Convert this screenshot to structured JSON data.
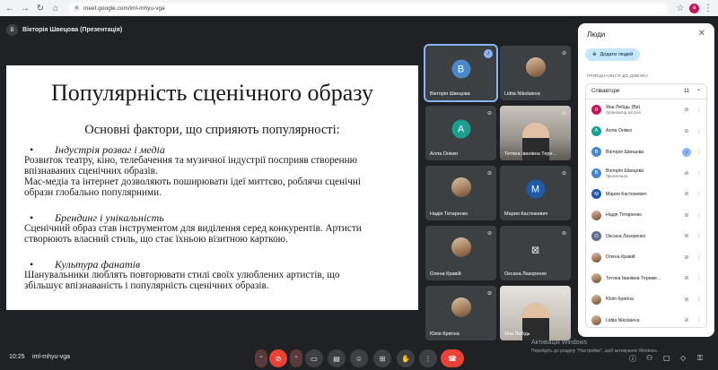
{
  "browser": {
    "url": "meet.google.com/iml-mhyu-vga",
    "profile_initial": "a"
  },
  "presenter": {
    "initial": "В",
    "label": "Вікторія Швецова (Презентація)"
  },
  "slide": {
    "title": "Популярність сценічного образу",
    "subtitle": "Основні фактори, що сприяють популярності:",
    "sections": [
      {
        "heading": "Індустрія розваг і медіа",
        "lines": [
          "Розвиток театру, кіно, телебачення та музичної індустрії посприяв створенню",
          "впізнаваних сценічних образів.",
          "Мас-медіа та інтернет дозволяють поширювати ідеї миттєво, роблячи сценічні",
          "образи глобально популярними."
        ]
      },
      {
        "heading": "Брендинг і унікальність",
        "lines": [
          "Сценічний образ став інструментом для виділення серед конкурентів.  Артисти",
          "створюють власний стиль, що стає їхньою візитною карткою."
        ]
      },
      {
        "heading": "Культура фанатів",
        "lines": [
          "Шанувальники люблять повторювати стилі своїх улюблених артистів, що",
          "збільшує впізнаваність і популярність сценічних образів."
        ]
      }
    ]
  },
  "tiles": [
    {
      "name": "Вікторія Швецова",
      "initial": "В",
      "color": "#4a89c8",
      "kind": "avatar",
      "speaking": true
    },
    {
      "name": "Lidiia Nikolaieva",
      "kind": "photo",
      "speaking": false
    },
    {
      "name": "Алла Онікко",
      "initial": "А",
      "color": "#1a9e8f",
      "kind": "avatar",
      "speaking": false
    },
    {
      "name": "Тетяна Іванівна Тере...",
      "kind": "video",
      "speaking": false
    },
    {
      "name": "Надія Титаренко",
      "kind": "photo",
      "speaking": false
    },
    {
      "name": "Мария Кастюкевич",
      "initial": "М",
      "color": "#1e5aa8",
      "kind": "avatar",
      "speaking": false
    },
    {
      "name": "Олена Кравій",
      "kind": "photo",
      "speaking": false
    },
    {
      "name": "Оксана Лазоренко",
      "kind": "blocked",
      "speaking": false
    },
    {
      "name": "Юлія Крягіна",
      "kind": "photo",
      "speaking": false
    },
    {
      "name": "Яна Лебідь",
      "kind": "room",
      "speaking": false
    }
  ],
  "panel": {
    "title": "Люди",
    "add_label": "Додати людей",
    "joined_label": "ПРИЄДНАЛИСЯ ДО ДЗВІНКА",
    "contributors_label": "Співавтори",
    "contributors_count": "11",
    "people": [
      {
        "name": "Яна Лебідь (Ви)",
        "role": "Організатор зустрічі",
        "initial": "Я",
        "color": "#c2185b",
        "mic": "muted"
      },
      {
        "name": "Алла Онікко",
        "role": "",
        "initial": "А",
        "color": "#1a9e8f",
        "mic": "muted"
      },
      {
        "name": "Вікторія Швецова",
        "role": "",
        "initial": "В",
        "color": "#4a89c8",
        "mic": "speaking"
      },
      {
        "name": "Вікторія Швецова",
        "role": "Презентація",
        "initial": "В",
        "color": "#4a89c8",
        "mic": "muted"
      },
      {
        "name": "Мария Кастюкевич",
        "role": "",
        "initial": "М",
        "color": "#1e5aa8",
        "mic": "muted"
      },
      {
        "name": "Надія Титаренко",
        "role": "",
        "initial": "",
        "color": "",
        "mic": "muted",
        "photo": true
      },
      {
        "name": "Оксана Лазоренко",
        "role": "",
        "initial": "О",
        "color": "#5f6f8f",
        "mic": "muted"
      },
      {
        "name": "Олена Кравій",
        "role": "",
        "initial": "",
        "color": "",
        "mic": "muted",
        "photo": true
      },
      {
        "name": "Тетяна Іванівна Тереме...",
        "role": "",
        "initial": "",
        "color": "",
        "mic": "muted",
        "photo": true
      },
      {
        "name": "Юлія Крягіна",
        "role": "",
        "initial": "",
        "color": "",
        "mic": "muted",
        "photo": true
      },
      {
        "name": "Lidiia Nikolaieva",
        "role": "",
        "initial": "",
        "color": "",
        "mic": "muted",
        "photo": true
      }
    ]
  },
  "bottom": {
    "time": "10:25",
    "meeting_code": "iml-mhyu-vga"
  },
  "watermark": {
    "line1": "Активація Windows",
    "line2": "Перейдіть до розділу \"Настройки\", щоб активувати Windows."
  },
  "icons": {
    "mic_muted": "mic-off-icon",
    "speaking": "sound-wave-icon",
    "more": "more-vert-icon"
  }
}
